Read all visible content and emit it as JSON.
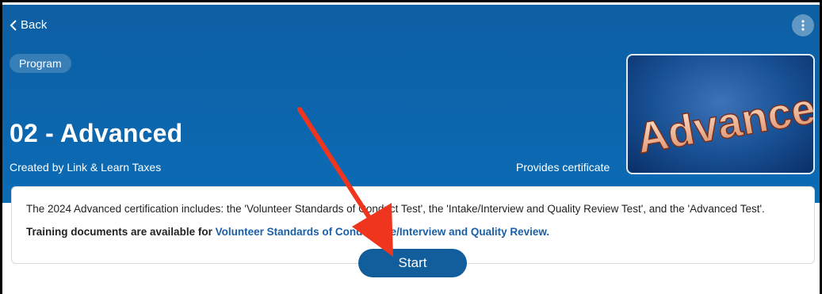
{
  "nav": {
    "back_label": "Back"
  },
  "header": {
    "badge": "Program",
    "title": "02 - Advanced",
    "creator": "Created by Link & Learn Taxes",
    "certificate": "Provides certificate"
  },
  "thumbnail": {
    "text": "Advanced"
  },
  "card": {
    "description": "The 2024 Advanced certification includes: the 'Volunteer Standards of Conduct Test', the 'Intake/Interview and Quality Review Test', and the 'Advanced Test'.",
    "docs_prefix": "Training documents are available for ",
    "docs_link_1": "Volunteer Standards of Cond",
    "docs_link_2": " Intake/Interview and Quality Review",
    "docs_suffix": "."
  },
  "actions": {
    "start_label": "Start"
  },
  "colors": {
    "header_blue": "#0c65ac",
    "button_blue": "#125d9c",
    "link_blue": "#1a5fa8",
    "annotation_arrow": "#f0351f"
  },
  "annotation": {
    "arrow": "red-arrow-pointing-to-start-button"
  }
}
